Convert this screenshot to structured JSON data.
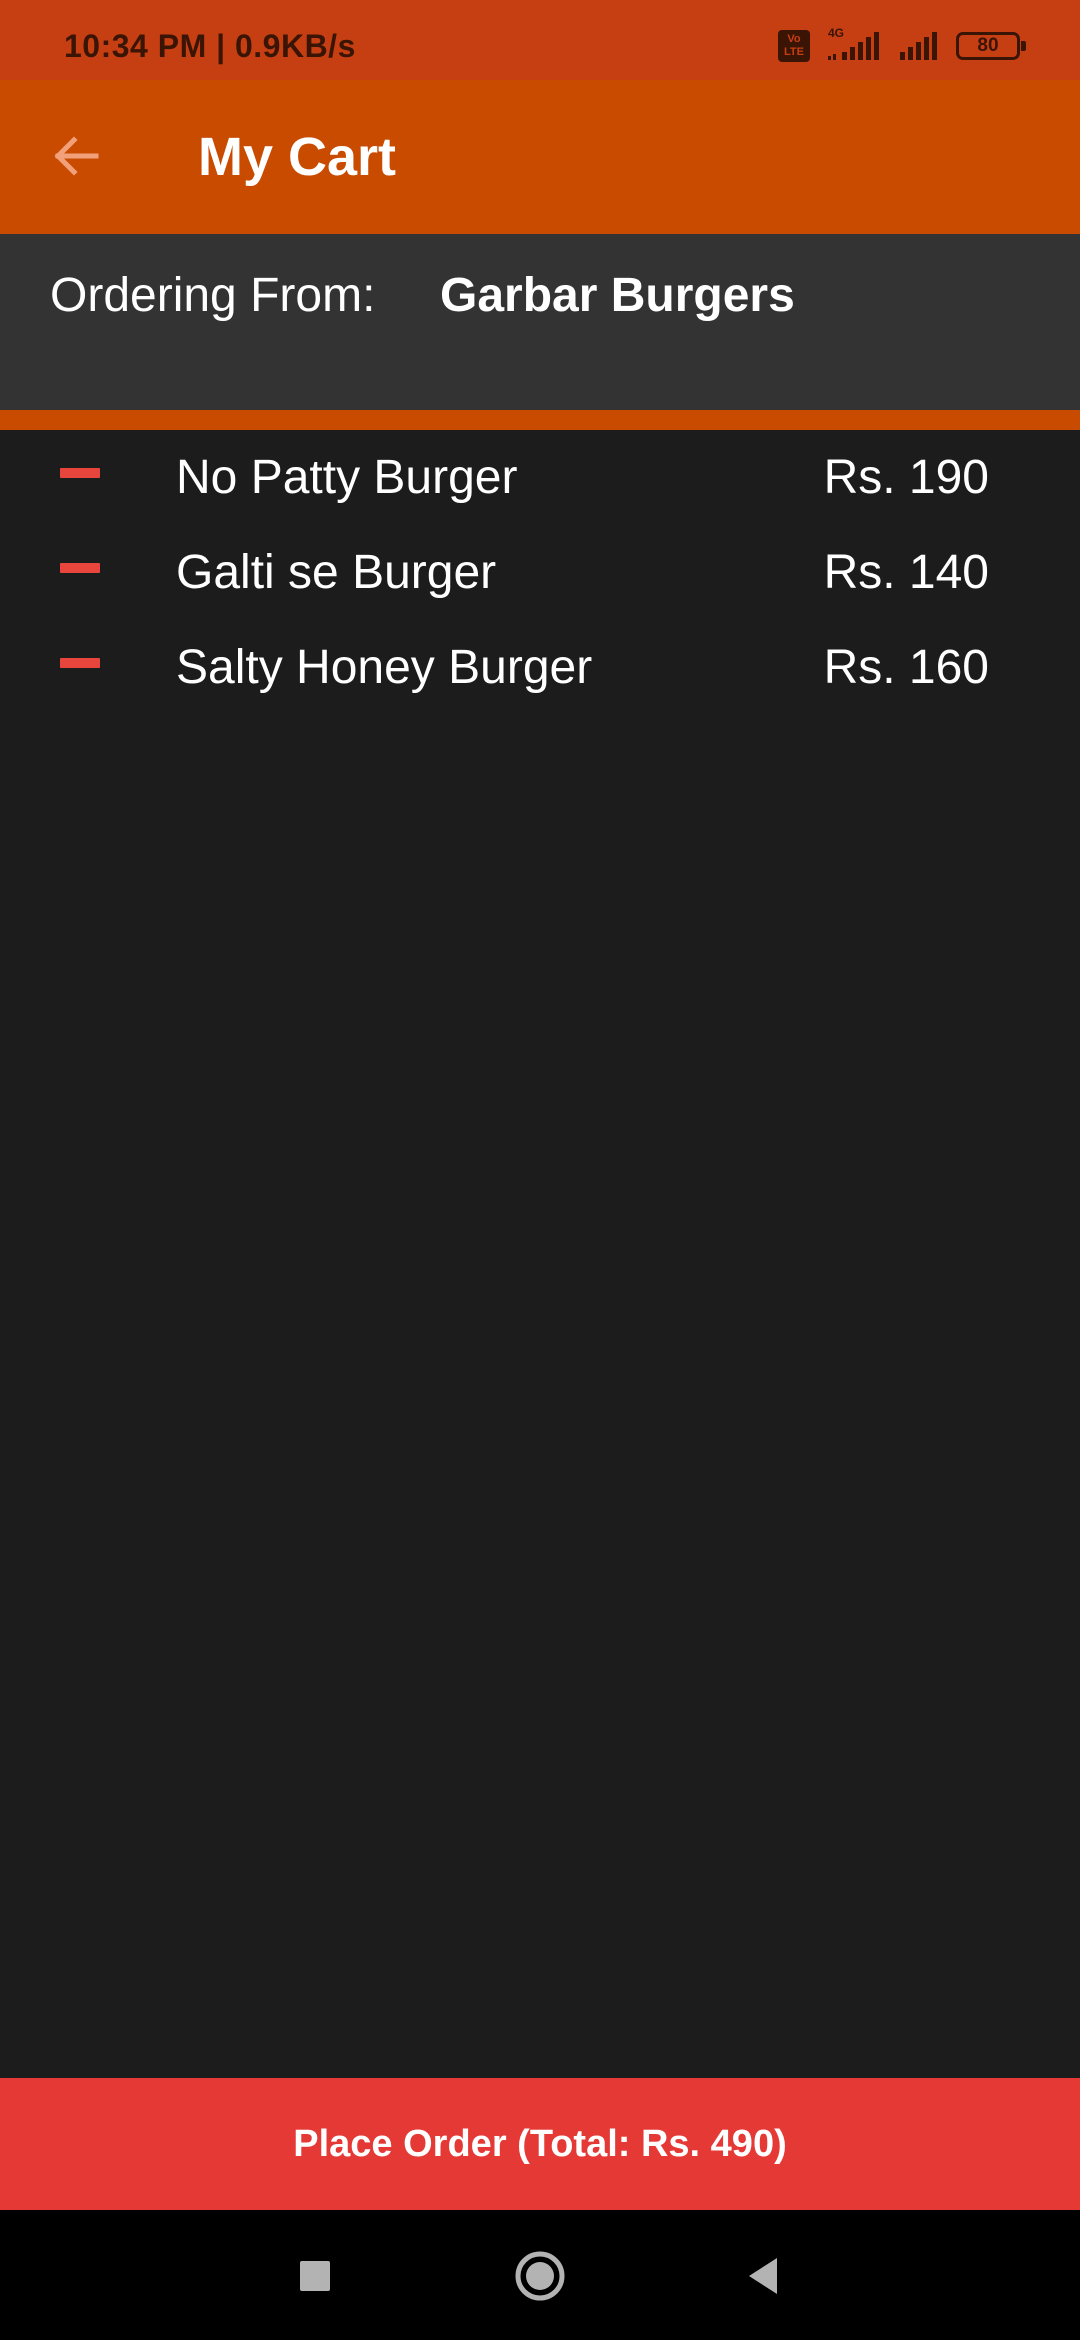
{
  "status_bar": {
    "time_speed": "10:34 PM | 0.9KB/s",
    "volte_label": "Vo LTE",
    "network_type": "4G",
    "battery_level": "80",
    "icons": [
      "volte-icon",
      "signal-4g-icon",
      "signal-icon",
      "battery-icon"
    ]
  },
  "app_bar": {
    "title": "My Cart",
    "back_icon": "arrow-left-icon"
  },
  "ordering": {
    "label": "Ordering From:",
    "restaurant": "Garbar Burgers"
  },
  "cart": {
    "items": [
      {
        "name": "No Patty Burger",
        "price": "Rs. 190",
        "remove_icon": "minus-icon"
      },
      {
        "name": "Galti se Burger",
        "price": "Rs. 140",
        "remove_icon": "minus-icon"
      },
      {
        "name": "Salty Honey Burger",
        "price": "Rs. 160",
        "remove_icon": "minus-icon"
      }
    ]
  },
  "place_order": {
    "label": "Place Order (Total: Rs. 490)"
  },
  "nav_bar": {
    "icons": [
      "recents-square-icon",
      "home-circle-icon",
      "back-triangle-icon"
    ]
  },
  "colors": {
    "status_bar": "#c63f12",
    "app_bar": "#c84b00",
    "ordering_panel": "#333333",
    "background": "#1c1c1c",
    "remove_accent": "#e8453c",
    "place_order_button": "#e53935",
    "nav_bar": "#000000"
  }
}
